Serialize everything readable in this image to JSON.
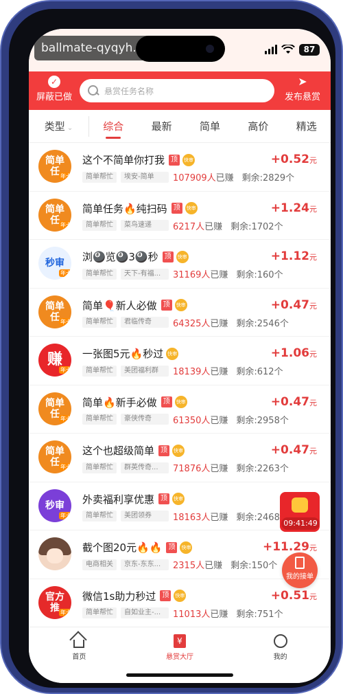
{
  "watermark": "ballmate-qyqyh.com",
  "status": {
    "battery": "87"
  },
  "header": {
    "shield_label": "屏蔽已做",
    "search_placeholder": "悬赏任务名称",
    "publish_label": "发布悬赏"
  },
  "filters": {
    "type_label": "类型",
    "tabs": [
      "综合",
      "最新",
      "简单",
      "高价",
      "精选"
    ]
  },
  "tasks": [
    {
      "title": "这个不简单你打我",
      "top": true,
      "tags": [
        "简单帮忙",
        "埃安-简单"
      ],
      "earned_count": "107909人",
      "earned_suffix": "已赚",
      "remaining": "剩余:2829个",
      "reward": "+0.52",
      "unit": "元",
      "avatar_text": "简单\n任"
    },
    {
      "title": "简单任务🔥纯扫码",
      "top": true,
      "tags": [
        "简单帮忙",
        "菜鸟速递"
      ],
      "earned_count": "6217人",
      "earned_suffix": "已赚",
      "remaining": "剩余:1702个",
      "reward": "+1.24",
      "unit": "元",
      "avatar_text": "简单\n任"
    },
    {
      "title": "浏🎱览🎱3🎱秒",
      "top": true,
      "tags": [
        "简单帮忙",
        "天下-有福..."
      ],
      "earned_count": "31169人",
      "earned_suffix": "已赚",
      "remaining": "剩余:160个",
      "reward": "+1.12",
      "unit": "元",
      "avatar_text": "秒审"
    },
    {
      "title": "简单🎈新人必做",
      "top": true,
      "tags": [
        "简单帮忙",
        "君临传奇"
      ],
      "earned_count": "64325人",
      "earned_suffix": "已赚",
      "remaining": "剩余:2546个",
      "reward": "+0.47",
      "unit": "元",
      "avatar_text": "简单\n任"
    },
    {
      "title": "一张图5元🔥秒过",
      "top": false,
      "tags": [
        "简单帮忙",
        "美团福利群"
      ],
      "earned_count": "18139人",
      "earned_suffix": "已赚",
      "remaining": "剩余:612个",
      "reward": "+1.06",
      "unit": "元",
      "avatar_text": "赚"
    },
    {
      "title": "简单🔥新手必做",
      "top": true,
      "tags": [
        "简单帮忙",
        "豪侠传奇"
      ],
      "earned_count": "61350人",
      "earned_suffix": "已赚",
      "remaining": "剩余:2958个",
      "reward": "+0.47",
      "unit": "元",
      "avatar_text": "简单\n任"
    },
    {
      "title": "这个也超级简单",
      "top": true,
      "tags": [
        "简单帮忙",
        "群英传奇..."
      ],
      "earned_count": "71876人",
      "earned_suffix": "已赚",
      "remaining": "剩余:2263个",
      "reward": "+0.47",
      "unit": "元",
      "avatar_text": "简单\n任"
    },
    {
      "title": "外卖福利享优惠",
      "top": true,
      "tags": [
        "简单帮忙",
        "美团领券"
      ],
      "earned_count": "18163人",
      "earned_suffix": "已赚",
      "remaining": "剩余:2468个",
      "reward": "",
      "unit": "",
      "avatar_text": "秒审"
    },
    {
      "title": "截个图20元🔥🔥",
      "top": true,
      "tags": [
        "电商相关",
        "京东-东东..."
      ],
      "earned_count": "2315人",
      "earned_suffix": "已赚",
      "remaining": "剩余:150个",
      "reward": "+11.29",
      "unit": "元",
      "avatar_text": ""
    },
    {
      "title": "微信1s助力秒过",
      "top": true,
      "tags": [
        "简单帮忙",
        "自如业主-..."
      ],
      "earned_count": "11013人",
      "earned_suffix": "已赚",
      "remaining": "剩余:751个",
      "reward": "+0.51",
      "unit": "元",
      "avatar_text": "官方\n推"
    }
  ],
  "badges": {
    "top": "顶",
    "fast": "快审",
    "annual": "年卡"
  },
  "float": {
    "countdown": "09:41:49",
    "my_orders": "我的接单"
  },
  "nav": {
    "home": "首页",
    "hall": "悬赏大厅",
    "me": "我的",
    "hall_icon": "¥"
  },
  "colors": {
    "primary": "#f23d3d",
    "accent": "#e23c3c"
  }
}
